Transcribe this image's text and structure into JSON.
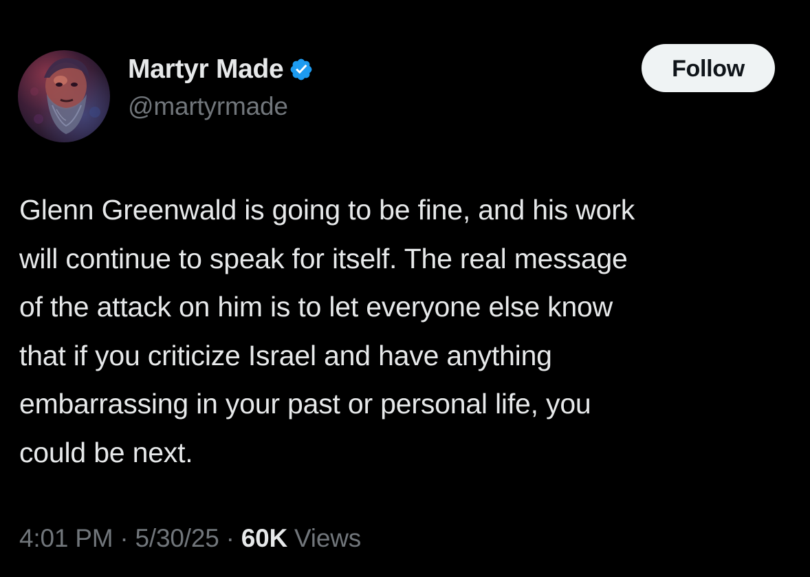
{
  "author": {
    "display_name": "Martyr Made",
    "handle": "@martyrmade",
    "verified": true,
    "avatar_icon": "bearded-man-portrait-avatar"
  },
  "follow_button": {
    "label": "Follow"
  },
  "tweet": {
    "lines": [
      "Glenn Greenwald is going to be fine, and his work",
      "will continue to speak for itself. The real message",
      "of the attack on him is to let everyone else know",
      "that if you criticize Israel and have anything",
      "embarrassing in your past or personal life, you",
      "could be next."
    ]
  },
  "meta": {
    "time": "4:01 PM",
    "separator": "·",
    "date": "5/30/25",
    "views_count": "60K",
    "views_label": "Views"
  },
  "colors": {
    "background": "#000000",
    "primary_text": "#e7e9ea",
    "secondary_text": "#71767b",
    "verified_badge": "#1d9bf0",
    "follow_button_bg": "#eff3f4",
    "follow_button_text": "#0f1419"
  }
}
